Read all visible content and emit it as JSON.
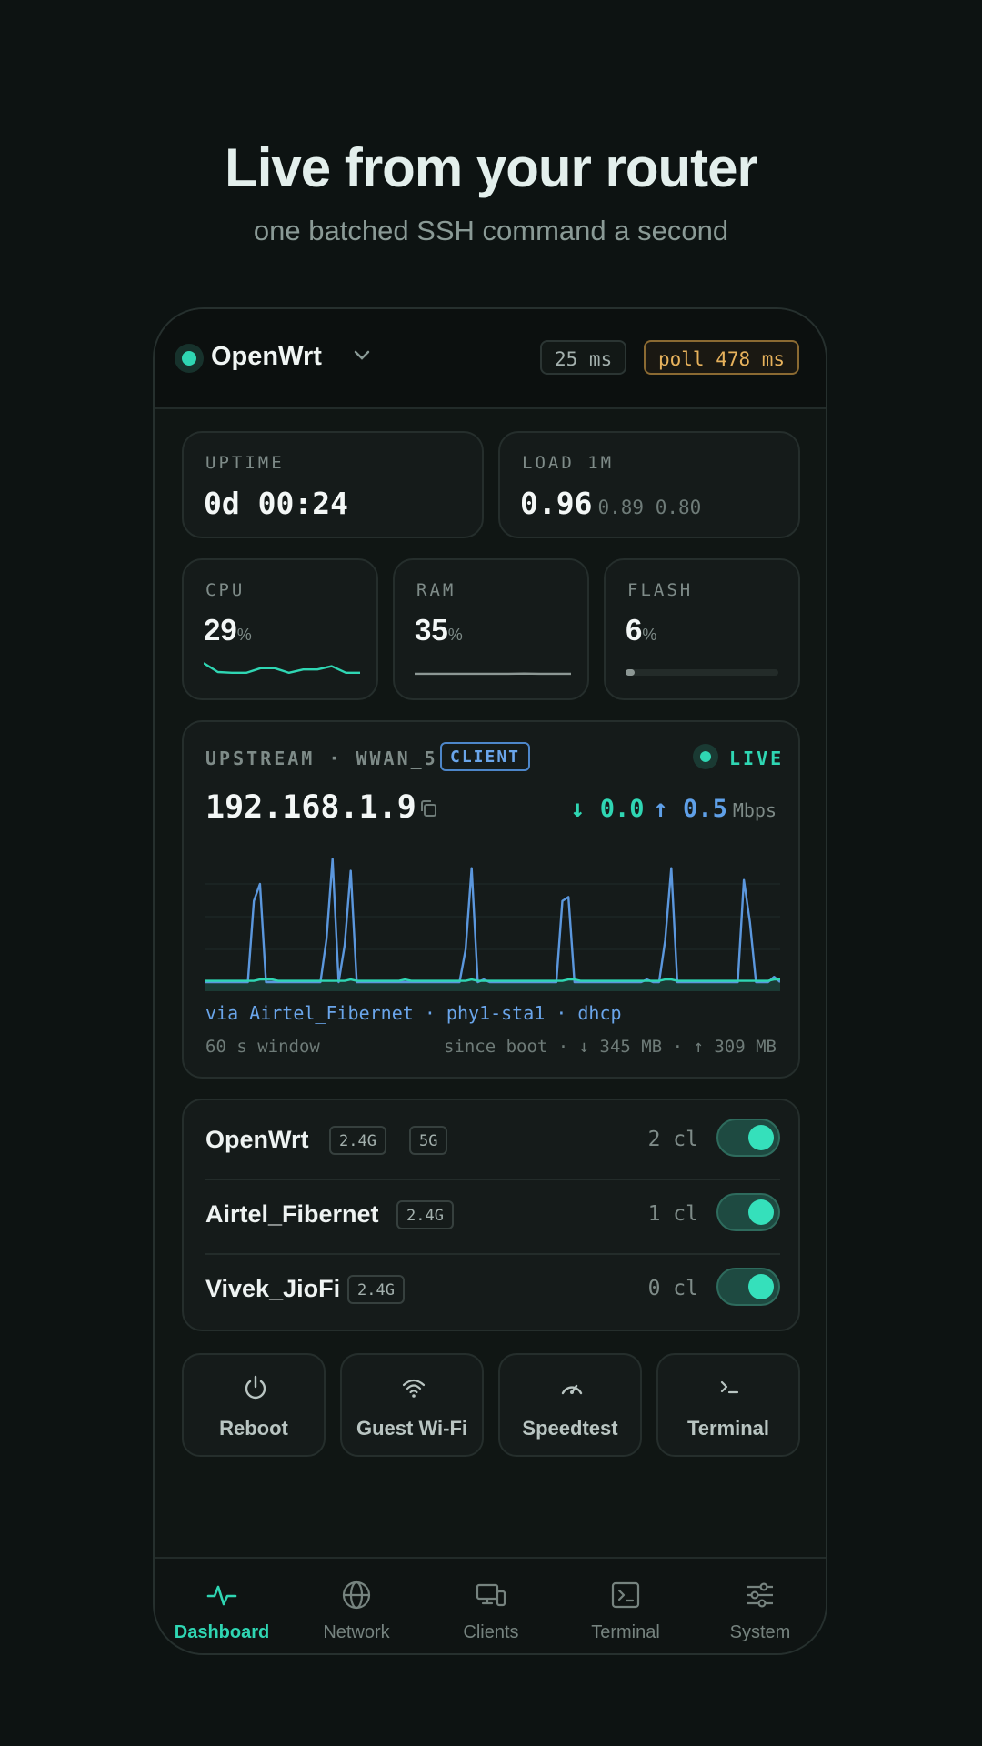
{
  "hero": {
    "title": "Live from your router",
    "subtitle": "one batched SSH command a second"
  },
  "header": {
    "router_name": "OpenWrt",
    "latency": "25 ms",
    "poll": "poll 478 ms",
    "status_color": "#2fd6b3",
    "poll_color": "#e7b25c"
  },
  "stats": {
    "uptime": {
      "label": "UPTIME",
      "value": "0d 00:24"
    },
    "load": {
      "label": "LOAD 1M",
      "value": "0.96",
      "secondary": "0.89 0.80"
    },
    "cpu": {
      "label": "CPU",
      "value": "29",
      "unit": "%",
      "sparkline": [
        60,
        25,
        22,
        22,
        40,
        40,
        22,
        35,
        35,
        48,
        22,
        22
      ]
    },
    "ram": {
      "label": "RAM",
      "value": "35",
      "unit": "%",
      "sparkline": [
        18,
        18,
        18,
        18,
        18,
        18,
        18,
        19,
        18,
        18,
        18
      ]
    },
    "flash": {
      "label": "FLASH",
      "value": "6",
      "unit": "%",
      "fill_fraction": 0.06
    }
  },
  "upstream": {
    "label": "UPSTREAM · WWAN_5",
    "badge": "CLIENT",
    "live": "LIVE",
    "ip": "192.168.1.9",
    "down": "↓ 0.0",
    "up": "↑ 0.5",
    "unit": "Mbps",
    "via": "via Airtel_Fibernet · phy1-sta1 · dhcp",
    "window": "60 s window",
    "since_boot": "since boot · ↓ 345 MB · ↑ 309 MB",
    "chart_up_series": [
      0,
      0,
      0,
      0,
      0,
      0,
      0,
      0,
      62,
      75,
      0,
      0,
      0,
      0,
      0,
      0,
      0,
      0,
      0,
      0,
      33,
      94,
      0,
      28,
      85,
      0,
      0,
      0,
      0,
      0,
      0,
      0,
      0,
      0,
      0,
      0,
      0,
      0,
      0,
      0,
      0,
      0,
      0,
      25,
      87,
      0,
      2,
      0,
      0,
      0,
      0,
      0,
      0,
      0,
      0,
      0,
      0,
      0,
      0,
      62,
      65,
      0,
      0,
      0,
      0,
      0,
      0,
      0,
      0,
      0,
      0,
      0,
      0,
      2,
      0,
      0,
      32,
      87,
      0,
      0,
      0,
      0,
      0,
      0,
      0,
      0,
      0,
      0,
      0,
      78,
      46,
      0,
      0,
      0,
      4,
      0
    ],
    "chart_down_series": [
      1,
      1,
      1,
      1,
      1,
      1,
      1,
      1,
      1,
      2,
      2,
      2,
      1,
      1,
      1,
      1,
      1,
      1,
      1,
      1,
      1,
      1,
      1,
      1,
      2,
      1,
      1,
      1,
      1,
      1,
      1,
      1,
      1,
      2,
      1,
      1,
      1,
      1,
      1,
      1,
      1,
      1,
      1,
      1,
      2,
      1,
      1,
      1,
      1,
      1,
      1,
      1,
      1,
      1,
      1,
      1,
      1,
      1,
      1,
      1,
      2,
      2,
      1,
      1,
      1,
      1,
      1,
      1,
      1,
      1,
      1,
      1,
      1,
      1,
      1,
      1,
      2,
      2,
      1,
      1,
      1,
      1,
      1,
      1,
      1,
      1,
      1,
      1,
      1,
      1,
      1,
      1,
      1,
      1,
      2,
      2
    ]
  },
  "wifi": [
    {
      "ssid": "OpenWrt",
      "bands": [
        "2.4G",
        "5G"
      ],
      "clients": "2 cl",
      "enabled": true
    },
    {
      "ssid": "Airtel_Fibernet",
      "bands": [
        "2.4G"
      ],
      "clients": "1 cl",
      "enabled": true
    },
    {
      "ssid": "Vivek_JioFi",
      "bands": [
        "2.4G"
      ],
      "clients": "0 cl",
      "enabled": true
    }
  ],
  "actions": [
    {
      "label": "Reboot",
      "icon": "power-icon"
    },
    {
      "label": "Guest Wi-Fi",
      "icon": "wifi-icon"
    },
    {
      "label": "Speedtest",
      "icon": "gauge-icon"
    },
    {
      "label": "Terminal",
      "icon": "prompt-icon"
    }
  ],
  "nav": [
    {
      "label": "Dashboard",
      "icon": "activity-icon",
      "active": true
    },
    {
      "label": "Network",
      "icon": "globe-icon",
      "active": false
    },
    {
      "label": "Clients",
      "icon": "devices-icon",
      "active": false
    },
    {
      "label": "Terminal",
      "icon": "terminal-icon",
      "active": false
    },
    {
      "label": "System",
      "icon": "sliders-icon",
      "active": false
    }
  ]
}
